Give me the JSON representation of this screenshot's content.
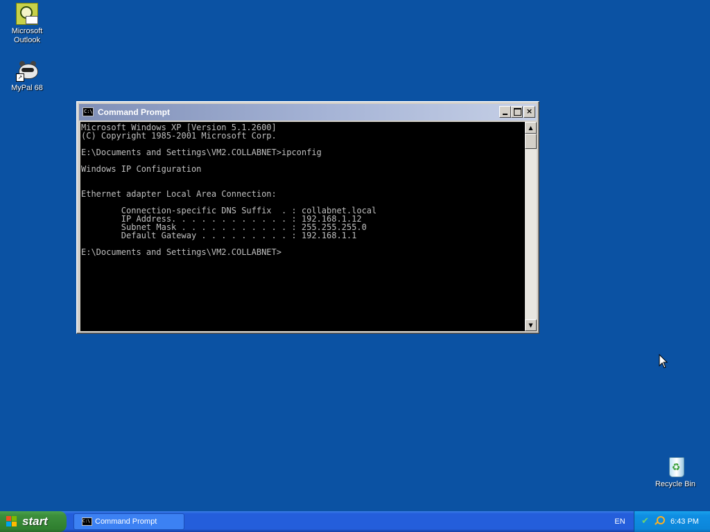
{
  "desktop": {
    "icons": [
      {
        "label": "Microsoft\nOutlook",
        "line1": "Microsoft",
        "line2": "Outlook",
        "icon": "outlook-icon"
      },
      {
        "label": "MyPal 68",
        "icon": "mypal-raccoon-icon"
      },
      {
        "label": "Recycle Bin",
        "icon": "recycle-bin-icon"
      }
    ],
    "background_color": "#0b52a3"
  },
  "window": {
    "title": "Command Prompt",
    "icon": "cmd-icon",
    "icon_text": "C:\\",
    "controls": {
      "minimize": "minimize",
      "maximize": "maximize",
      "close": "×"
    },
    "console_lines": [
      "Microsoft Windows XP [Version 5.1.2600]",
      "(C) Copyright 1985-2001 Microsoft Corp.",
      "",
      "E:\\Documents and Settings\\VM2.COLLABNET>ipconfig",
      "",
      "Windows IP Configuration",
      "",
      "",
      "Ethernet adapter Local Area Connection:",
      "",
      "        Connection-specific DNS Suffix  . : collabnet.local",
      "        IP Address. . . . . . . . . . . . : 192.168.1.12",
      "        Subnet Mask . . . . . . . . . . . : 255.255.255.0",
      "        Default Gateway . . . . . . . . . : 192.168.1.1",
      "",
      "E:\\Documents and Settings\\VM2.COLLABNET>"
    ],
    "scroll_up": "▲",
    "scroll_down": "▼"
  },
  "taskbar": {
    "start_label": "start",
    "tasks": [
      {
        "label": "Command Prompt",
        "icon": "cmd-icon",
        "icon_text": "C:\\"
      }
    ],
    "language": "EN",
    "clock": "6:43 PM",
    "tray_icons": [
      "network-icon",
      "search-icon"
    ]
  }
}
